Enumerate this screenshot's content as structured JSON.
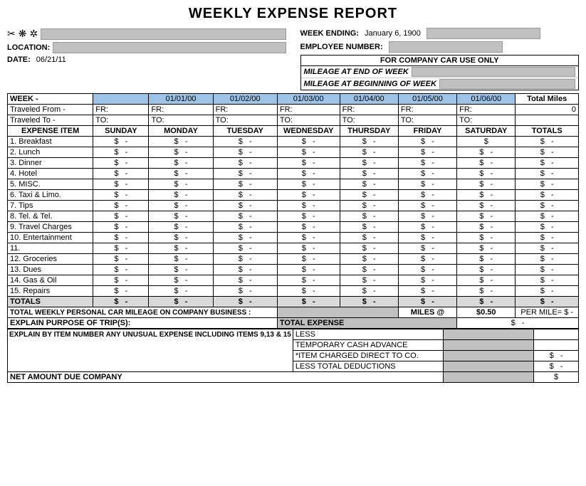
{
  "title": "WEEKLY EXPENSE REPORT",
  "header": {
    "week_ending_label": "WEEK ENDING:",
    "week_ending_value": "January 6, 1900",
    "employee_number_label": "EMPLOYEE NUMBER:",
    "location_label": "LOCATION:",
    "date_label": "DATE:",
    "date_value": "06/21/11",
    "company_car_title": "FOR COMPANY CAR USE ONLY",
    "mileage_end": "MILEAGE AT END OF WEEK",
    "mileage_begin": "MILEAGE AT BEGINNING OF WEEK"
  },
  "week_row": {
    "label": "WEEK -",
    "dates": [
      "01/01/00",
      "01/02/00",
      "01/03/00",
      "01/04/00",
      "01/05/00",
      "01/06/00"
    ],
    "total_miles_label": "Total Miles",
    "total_miles_value": "0"
  },
  "traveled_from": {
    "label": "Traveled From -",
    "fr_label": "FR:"
  },
  "traveled_to": {
    "label": "Traveled To -",
    "to_label": "TO:"
  },
  "columns": {
    "expense_item": "EXPENSE ITEM",
    "sunday": "SUNDAY",
    "monday": "MONDAY",
    "tuesday": "TUESDAY",
    "wednesday": "WEDNESDAY",
    "thursday": "THURSDAY",
    "friday": "FRIDAY",
    "saturday": "SATURDAY",
    "totals": "TOTALS"
  },
  "expense_items": [
    "1. Breakfast",
    "2. Lunch",
    "3. Dinner",
    "4. Hotel",
    "5. MISC.",
    "6. Taxi & Limo.",
    "7. Tips",
    "8. Tel. & Tel.",
    "9. Travel Charges",
    "10. Entertainment",
    "11.",
    "12. Groceries",
    "13. Dues",
    "14. Gas & Oil",
    "15. Repairs",
    "TOTALS"
  ],
  "dollar_sign": "$",
  "dash": "-",
  "mileage_row": {
    "label": "TOTAL WEEKLY PERSONAL CAR MILEAGE ON COMPANY BUSINESS :",
    "miles_at": "MILES @",
    "rate": "$0.50",
    "per_mile": "PER MILE="
  },
  "explain_row": {
    "label": "EXPLAIN PURPOSE OF TRIP(S):",
    "total_expense_label": "TOTAL EXPENSE"
  },
  "summary": {
    "less_label": "LESS",
    "temp_cash_label": "TEMPORARY CASH ADVANCE",
    "item_charged_label": "*ITEM CHARGED DIRECT TO CO.",
    "less_total_label": "LESS TOTAL DEDUCTIONS",
    "net_amount_label": "NET AMOUNT DUE COMPANY"
  },
  "footer": {
    "explain_label": "EXPLAIN BY ITEM NUMBER ANY UNUSUAL EXPENSE INCLUDING ITEMS 9,13 & 15"
  }
}
